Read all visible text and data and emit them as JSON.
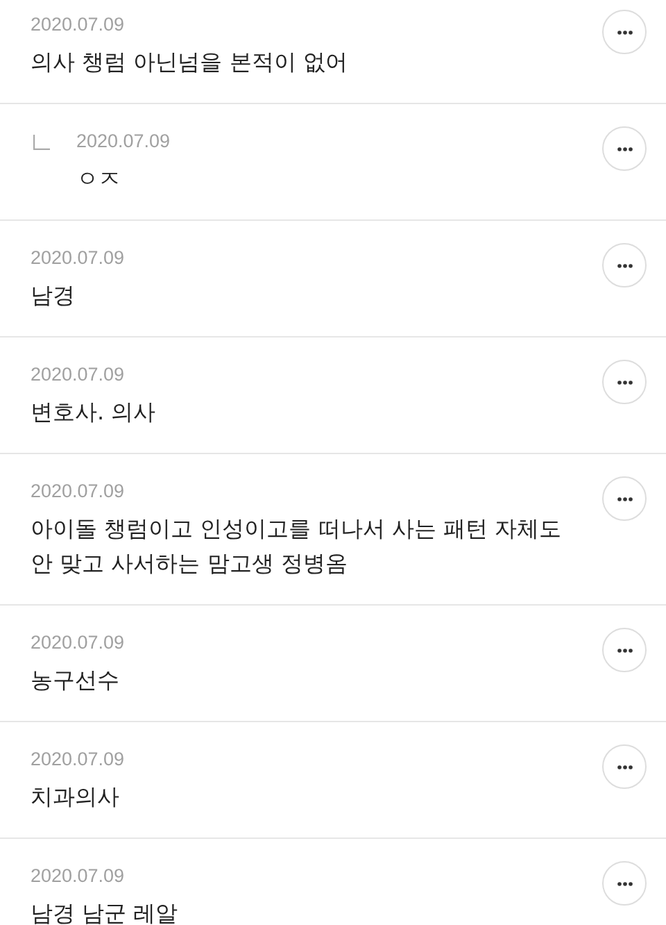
{
  "comments": [
    {
      "date": "2020.07.09",
      "text": "의사 챙럼 아닌넘을 본적이 없어",
      "children": [
        {
          "date": "2020.07.09",
          "text": "ㅇㅈ"
        }
      ]
    },
    {
      "date": "2020.07.09",
      "text": "남경"
    },
    {
      "date": "2020.07.09",
      "text": "변호사. 의사"
    },
    {
      "date": "2020.07.09",
      "text": "아이돌 챙럼이고 인성이고를 떠나서 사는 패턴 자체도 안 맞고 사서하는 맘고생 정병옴"
    },
    {
      "date": "2020.07.09",
      "text": "농구선수"
    },
    {
      "date": "2020.07.09",
      "text": "치과의사"
    },
    {
      "date": "2020.07.09",
      "text": "남경 남군 레알"
    }
  ]
}
